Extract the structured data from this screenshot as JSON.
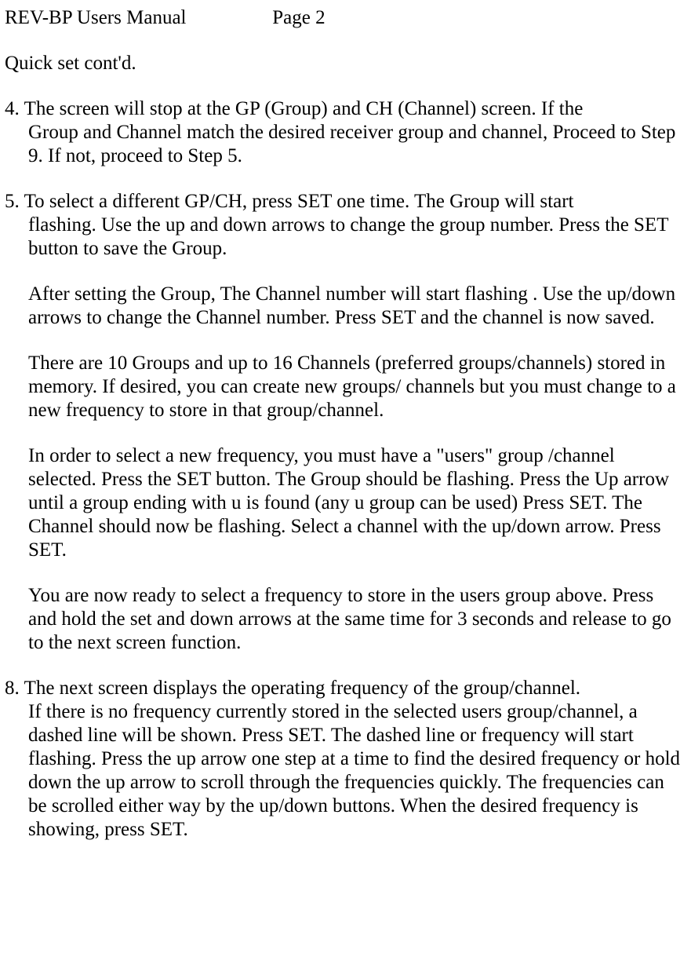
{
  "header": {
    "title": "REV-BP Users Manual",
    "page": "Page 2"
  },
  "subtitle": "Quick set cont'd.",
  "items": [
    {
      "num": "4.",
      "first": "The screen will stop at the GP (Group) and CH (Channel) screen. If the",
      "cont": "Group and Channel match the desired receiver group and channel, Proceed to Step 9. If not, proceed to Step 5."
    },
    {
      "num": "5.",
      "first": "To select a different GP/CH, press SET one time. The Group will start",
      "cont": "flashing. Use the up and down arrows to change the group number. Press the SET button to save the Group.",
      "paras": [
        "After setting the Group, The Channel number will start flashing . Use the up/down arrows to change the Channel number. Press SET and the channel is now saved.",
        "There are 10 Groups and up to 16 Channels (preferred groups/channels) stored in memory. If desired, you can create new groups/ channels but you must change to a new frequency to store in that group/channel.",
        "In order to select a new frequency, you must have a \"users\" group  /channel selected. Press the SET button. The Group should be flashing. Press the Up arrow until a group ending with u is found (any u group can be used) Press SET. The Channel should now be flashing. Select a channel with the up/down arrow. Press SET.",
        "You are now ready to select a frequency to store in the users group above. Press and hold the set and down arrows at the same time for 3  seconds and release to go to the next screen function."
      ]
    },
    {
      "num": "8.",
      "first": "The next screen displays the operating frequency of the group/channel.",
      "cont": "If there is no frequency currently stored in the selected users group/channel, a dashed line will be shown. Press SET. The dashed line or frequency will start flashing. Press the up arrow one step at a time to find the desired frequency or hold down the up arrow to scroll through the frequencies quickly. The frequencies can be scrolled either way by the up/down buttons. When the desired frequency is showing, press SET."
    }
  ]
}
